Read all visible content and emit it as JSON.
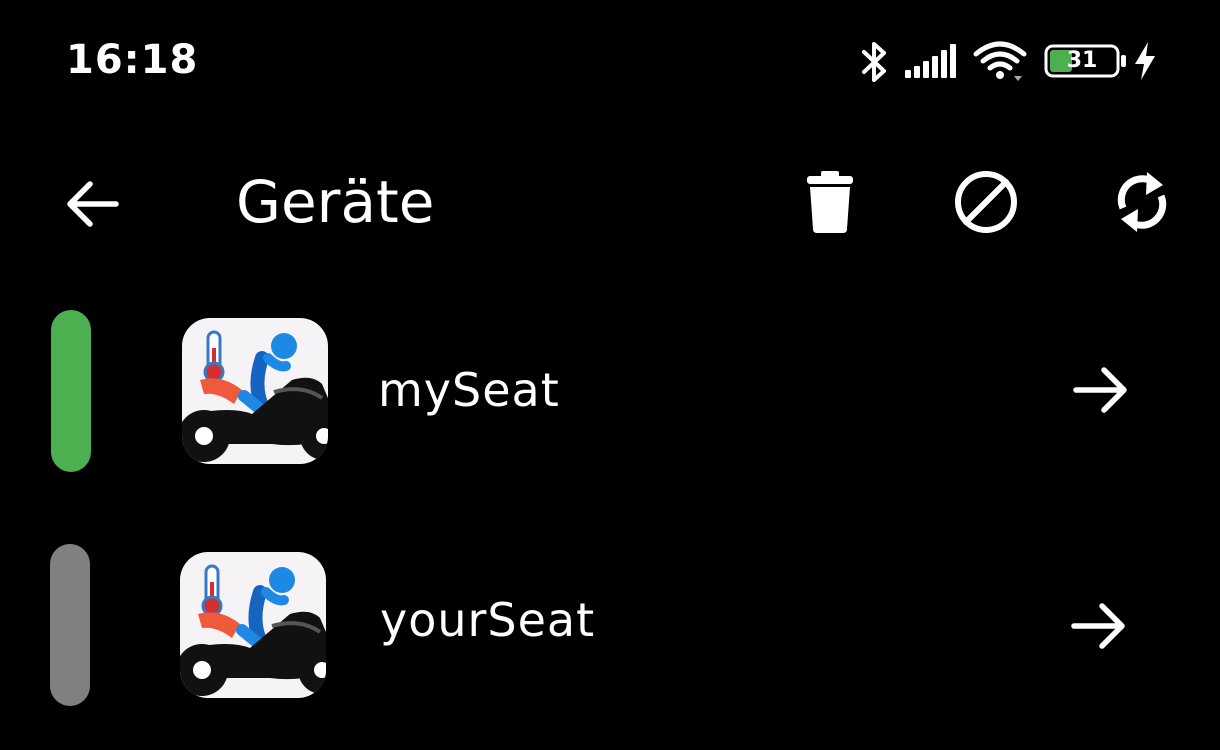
{
  "status_bar": {
    "time": "16:18",
    "battery_level": "31",
    "icons": [
      "bluetooth-icon",
      "signal-icon",
      "wifi-icon",
      "battery-icon",
      "charging-icon"
    ],
    "battery_color": "#4caf50"
  },
  "app_bar": {
    "title": "Geräte",
    "back_icon": "arrow-left-icon",
    "actions": [
      "trash-icon",
      "block-icon",
      "refresh-icon"
    ]
  },
  "devices": [
    {
      "name": "mySeat",
      "status_color": "#4caf50",
      "status": "connected"
    },
    {
      "name": "yourSeat",
      "status_color": "#808080",
      "status": "disconnected"
    }
  ]
}
